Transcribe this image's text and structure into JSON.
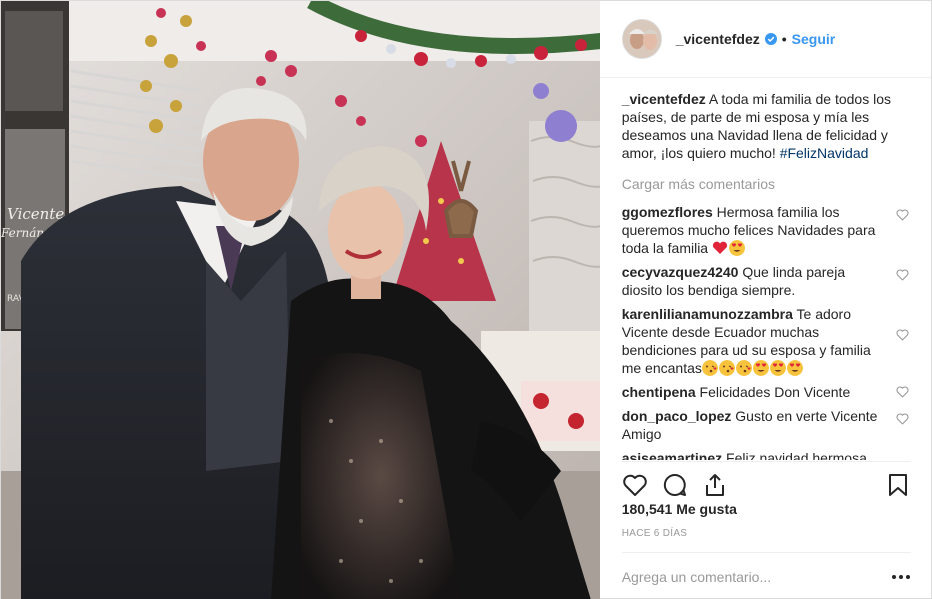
{
  "post": {
    "username": "_vicentefdez",
    "follow_label": "Seguir",
    "separator": "•",
    "caption_user": "_vicentefdez",
    "caption_text": " A toda mi familia de todos los países, de parte de mi esposa y mía les deseamos una Navidad llena de felicidad y amor, ¡los quiero mucho! ",
    "caption_tag": "#FelizNavidad",
    "load_more": "Cargar más comentarios",
    "likes": "180,541 Me gusta",
    "time_ago": "Hace 6 días",
    "comment_placeholder": "Agrega un comentario..."
  },
  "comments": [
    {
      "user": "ggomezflores",
      "text": " Hermosa familia los queremos mucho felices Navidades para toda la familia "
    },
    {
      "user": "cecyvazquez4240",
      "text": " Que linda pareja diosito los bendiga siempre."
    },
    {
      "user": "karenlilianamunozzambra",
      "text": " Te adoro Vicente desde Ecuador muchas bendiciones para ud su esposa y familia me encantas"
    },
    {
      "user": "chentipena",
      "text": " Felicidades Don Vicente"
    },
    {
      "user": "don_paco_lopez",
      "text": " Gusto en verte Vicente Amigo"
    },
    {
      "user": "asiseamartinez",
      "text": " Feliz navidad hermosa"
    }
  ],
  "photo_text": {
    "poster_line1": "Vicente",
    "poster_line2": "Fernández",
    "poster_line3": "RAVE"
  },
  "colors": {
    "link": "#3897f0",
    "hashtag": "#003569",
    "muted": "#999999",
    "verified": "#3897f0",
    "heart_red": "#ed4956"
  },
  "icons": [
    "verified-badge-icon",
    "like-heart-icon",
    "comment-icon",
    "share-icon",
    "bookmark-icon",
    "more-options-icon",
    "red-heart-emoji",
    "heart-eyes-emoji",
    "kiss-emoji"
  ]
}
